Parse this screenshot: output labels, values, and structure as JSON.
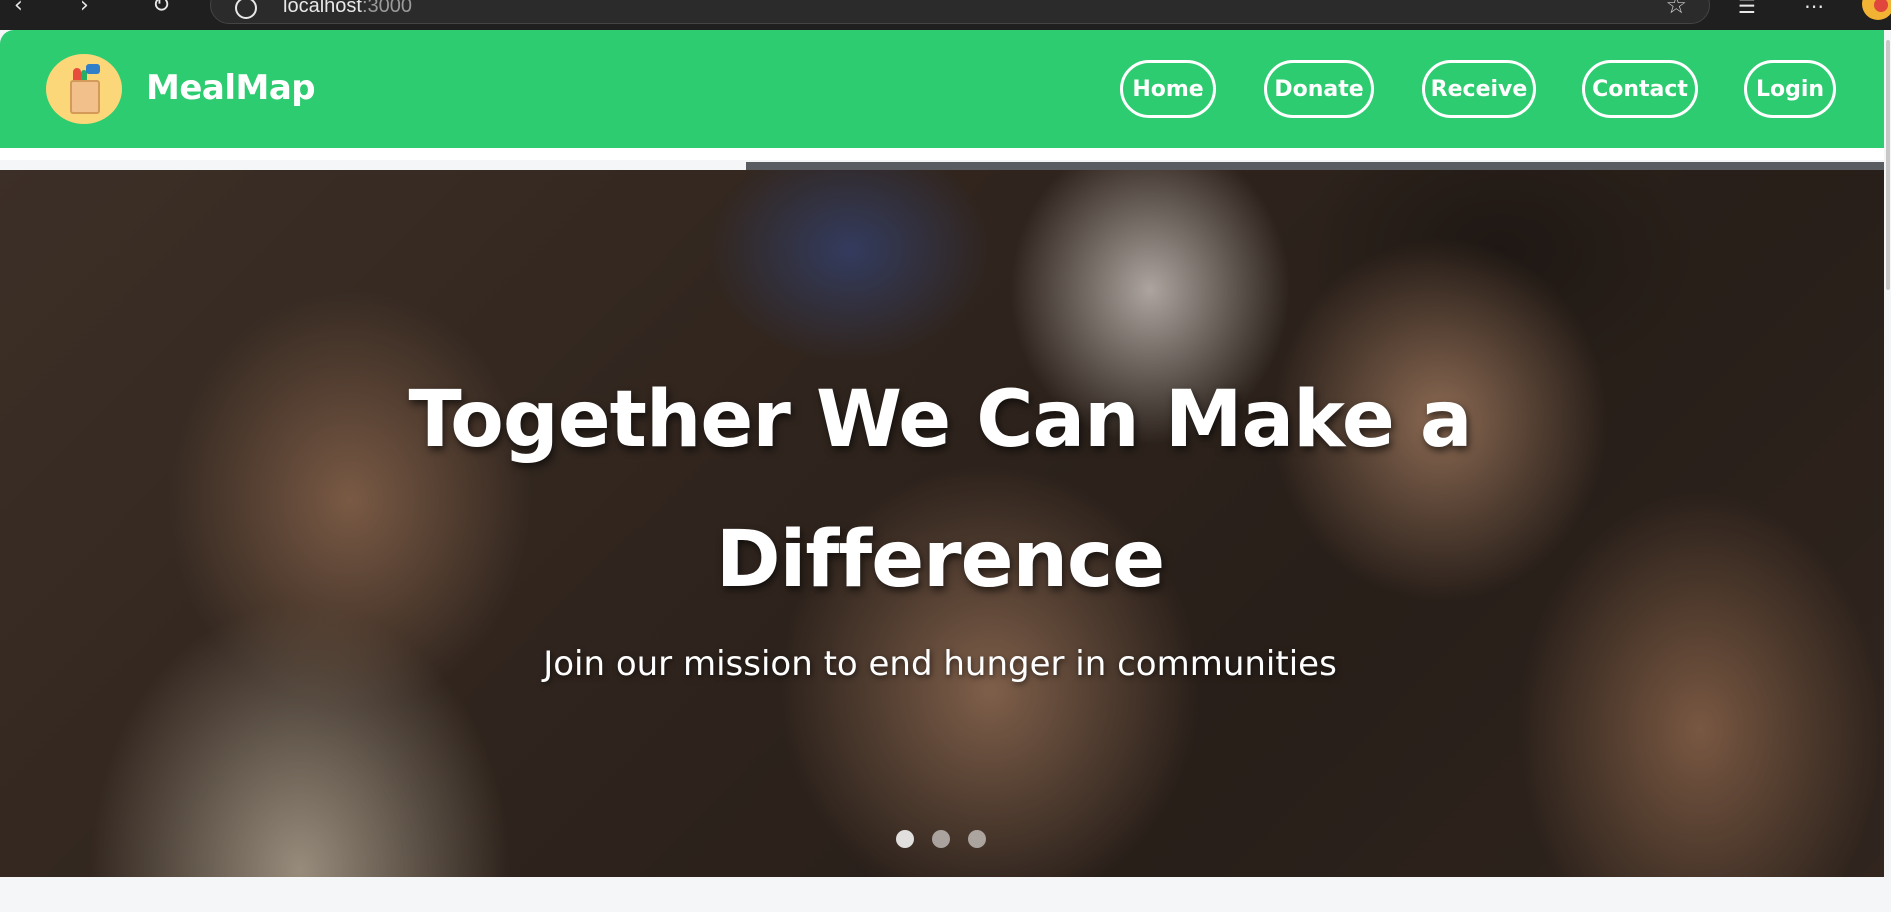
{
  "browser": {
    "url_host": "localhost",
    "url_port": ":3000",
    "back_icon": "back-arrow-icon",
    "forward_icon": "forward-arrow-icon",
    "refresh_icon": "refresh-icon",
    "star_icon": "bookmark-star-icon"
  },
  "navbar": {
    "brand": "MealMap",
    "logo_icon": "grocery-bag-icon",
    "links": [
      "Home",
      "Donate",
      "Receive",
      "Contact",
      "Login"
    ],
    "bg_color": "#2ecc71"
  },
  "hero": {
    "title": "Together We Can Make a Difference",
    "subtitle": "Join our mission to end hunger in communities",
    "carousel_slides": 3,
    "active_slide": 0
  }
}
